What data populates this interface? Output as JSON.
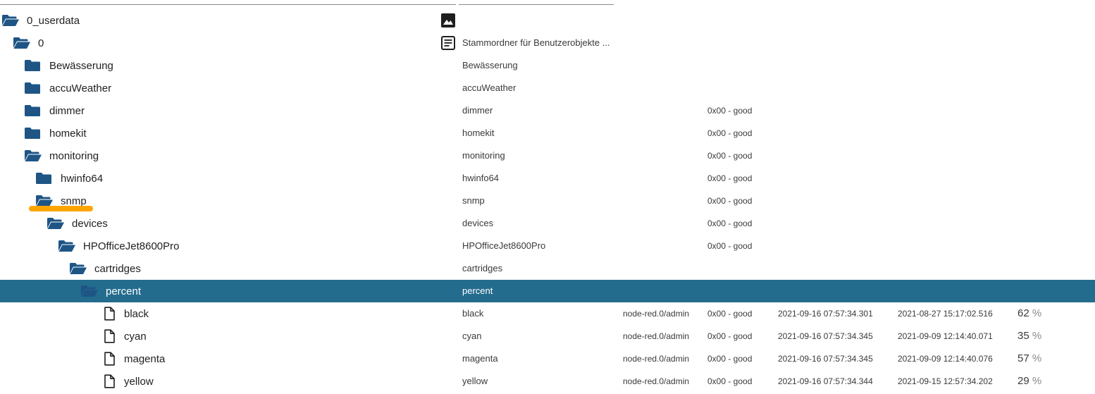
{
  "accent_color": "#236c8e",
  "folder_color": "#1e5585",
  "highlight_color": "#ffa500",
  "rows": [
    {
      "level": 0,
      "name": "0_userdata",
      "kind": "folder-open",
      "type_icon": "image-icon",
      "desc": "",
      "from": "",
      "quality": "",
      "ts": "",
      "lc": "",
      "value": "",
      "unit": "",
      "selected": false
    },
    {
      "level": 1,
      "name": "0",
      "kind": "folder-open",
      "type_icon": "document-icon",
      "desc": "Stammordner für Benutzerobjekte ...",
      "from": "",
      "quality": "",
      "ts": "",
      "lc": "",
      "value": "",
      "unit": "",
      "selected": false
    },
    {
      "level": 2,
      "name": "Bewässerung",
      "kind": "folder",
      "type_icon": "",
      "desc": "Bewässerung",
      "from": "",
      "quality": "",
      "ts": "",
      "lc": "",
      "value": "",
      "unit": "",
      "selected": false
    },
    {
      "level": 2,
      "name": "accuWeather",
      "kind": "folder",
      "type_icon": "",
      "desc": "accuWeather",
      "from": "",
      "quality": "",
      "ts": "",
      "lc": "",
      "value": "",
      "unit": "",
      "selected": false
    },
    {
      "level": 2,
      "name": "dimmer",
      "kind": "folder",
      "type_icon": "",
      "desc": "dimmer",
      "from": "",
      "quality": "0x00 - good",
      "ts": "",
      "lc": "",
      "value": "",
      "unit": "",
      "selected": false
    },
    {
      "level": 2,
      "name": "homekit",
      "kind": "folder",
      "type_icon": "",
      "desc": "homekit",
      "from": "",
      "quality": "0x00 - good",
      "ts": "",
      "lc": "",
      "value": "",
      "unit": "",
      "selected": false
    },
    {
      "level": 2,
      "name": "monitoring",
      "kind": "folder-open",
      "type_icon": "",
      "desc": "monitoring",
      "from": "",
      "quality": "0x00 - good",
      "ts": "",
      "lc": "",
      "value": "",
      "unit": "",
      "selected": false
    },
    {
      "level": 3,
      "name": "hwinfo64",
      "kind": "folder",
      "type_icon": "",
      "desc": "hwinfo64",
      "from": "",
      "quality": "0x00 - good",
      "ts": "",
      "lc": "",
      "value": "",
      "unit": "",
      "selected": false
    },
    {
      "level": 3,
      "name": "snmp",
      "kind": "folder-open",
      "type_icon": "",
      "desc": "snmp",
      "from": "",
      "quality": "0x00 - good",
      "ts": "",
      "lc": "",
      "value": "",
      "unit": "",
      "selected": false
    },
    {
      "level": 4,
      "name": "devices",
      "kind": "folder-open",
      "type_icon": "",
      "desc": "devices",
      "from": "",
      "quality": "0x00 - good",
      "ts": "",
      "lc": "",
      "value": "",
      "unit": "",
      "selected": false
    },
    {
      "level": 5,
      "name": "HPOfficeJet8600Pro",
      "kind": "folder-open",
      "type_icon": "",
      "desc": "HPOfficeJet8600Pro",
      "from": "",
      "quality": "0x00 - good",
      "ts": "",
      "lc": "",
      "value": "",
      "unit": "",
      "selected": false
    },
    {
      "level": 6,
      "name": "cartridges",
      "kind": "folder-open",
      "type_icon": "",
      "desc": "cartridges",
      "from": "",
      "quality": "",
      "ts": "",
      "lc": "",
      "value": "",
      "unit": "",
      "selected": false
    },
    {
      "level": 7,
      "name": "percent",
      "kind": "folder-open",
      "type_icon": "",
      "desc": "percent",
      "from": "",
      "quality": "",
      "ts": "",
      "lc": "",
      "value": "",
      "unit": "",
      "selected": true
    },
    {
      "level": 8,
      "name": "black",
      "kind": "file",
      "type_icon": "",
      "desc": "black",
      "from": "node-red.0/admin",
      "quality": "0x00 - good",
      "ts": "2021-09-16 07:57:34.301",
      "lc": "2021-08-27 15:17:02.516",
      "value": "62",
      "unit": "%",
      "selected": false
    },
    {
      "level": 8,
      "name": "cyan",
      "kind": "file",
      "type_icon": "",
      "desc": "cyan",
      "from": "node-red.0/admin",
      "quality": "0x00 - good",
      "ts": "2021-09-16 07:57:34.345",
      "lc": "2021-09-09 12:14:40.071",
      "value": "35",
      "unit": "%",
      "selected": false
    },
    {
      "level": 8,
      "name": "magenta",
      "kind": "file",
      "type_icon": "",
      "desc": "magenta",
      "from": "node-red.0/admin",
      "quality": "0x00 - good",
      "ts": "2021-09-16 07:57:34.345",
      "lc": "2021-09-09 12:14:40.076",
      "value": "57",
      "unit": "%",
      "selected": false
    },
    {
      "level": 8,
      "name": "yellow",
      "kind": "file",
      "type_icon": "",
      "desc": "yellow",
      "from": "node-red.0/admin",
      "quality": "0x00 - good",
      "ts": "2021-09-16 07:57:34.344",
      "lc": "2021-09-15 12:57:34.202",
      "value": "29",
      "unit": "%",
      "selected": false
    }
  ]
}
